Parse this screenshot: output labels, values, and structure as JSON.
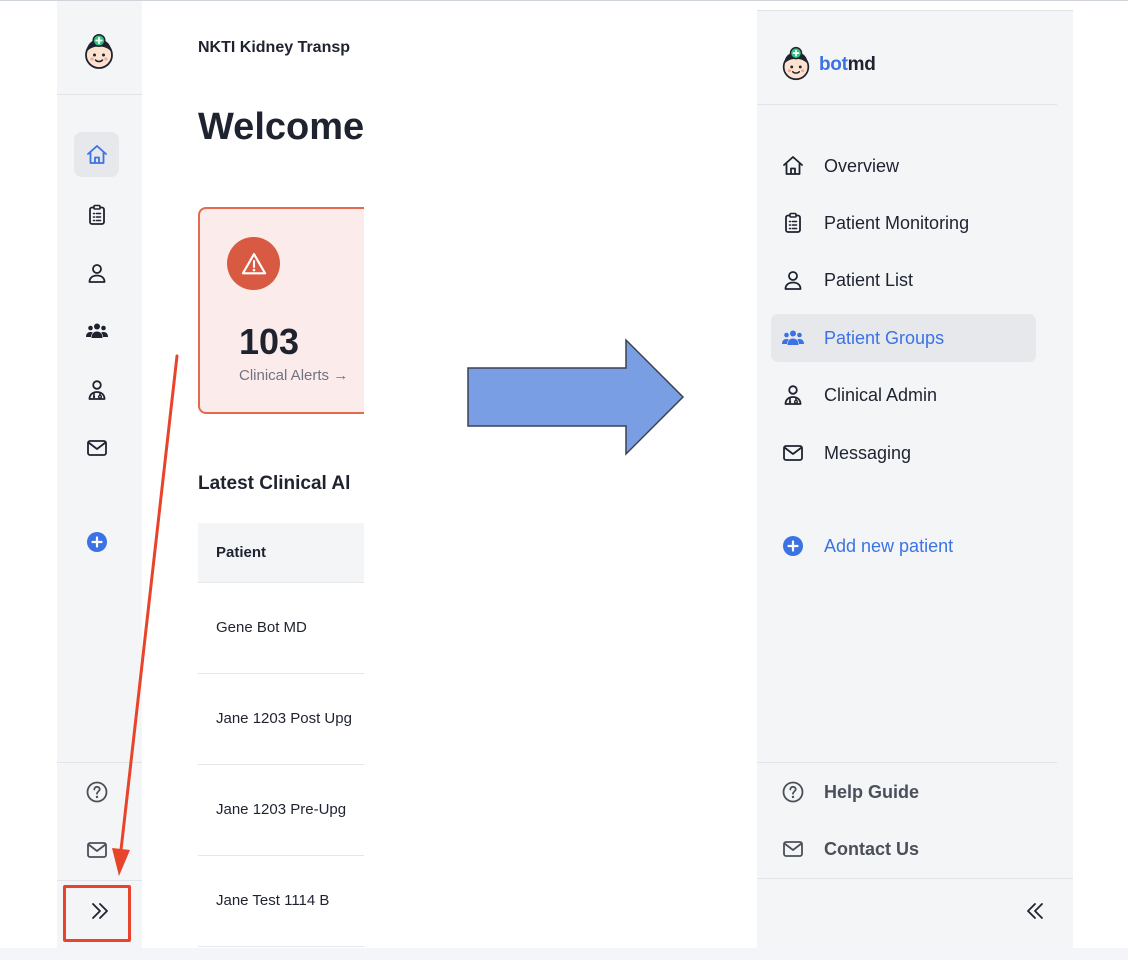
{
  "main": {
    "org_name": "NKTI Kidney Transp",
    "welcome": "Welcome,",
    "alert_card": {
      "count": "103",
      "label": "Clinical Alerts →"
    },
    "latest_heading": "Latest Clinical Al",
    "table": {
      "header": "Patient",
      "rows": [
        "Gene Bot MD",
        "Jane 1203 Post Upg",
        "Jane 1203 Pre-Upg",
        "Jane Test 1114 B"
      ]
    }
  },
  "brand": {
    "part1": "bot",
    "part2": "md"
  },
  "sidebar": {
    "items": [
      {
        "label": "Overview",
        "icon": "home-icon"
      },
      {
        "label": "Patient Monitoring",
        "icon": "clipboard-icon"
      },
      {
        "label": "Patient List",
        "icon": "user-icon"
      },
      {
        "label": "Patient Groups",
        "icon": "users-icon",
        "active": true
      },
      {
        "label": "Clinical Admin",
        "icon": "doctor-icon"
      },
      {
        "label": "Messaging",
        "icon": "mail-icon"
      }
    ],
    "add_patient": "Add new patient",
    "footer": [
      {
        "label": "Help Guide",
        "icon": "help-icon"
      },
      {
        "label": "Contact Us",
        "icon": "mail-icon"
      }
    ]
  },
  "colors": {
    "accent": "#3b73e4",
    "alert": "#d95a43",
    "annotation_red": "#e8442b",
    "arrow_fill": "#7a9ee3",
    "sidebar_bg": "#f4f5f7"
  }
}
